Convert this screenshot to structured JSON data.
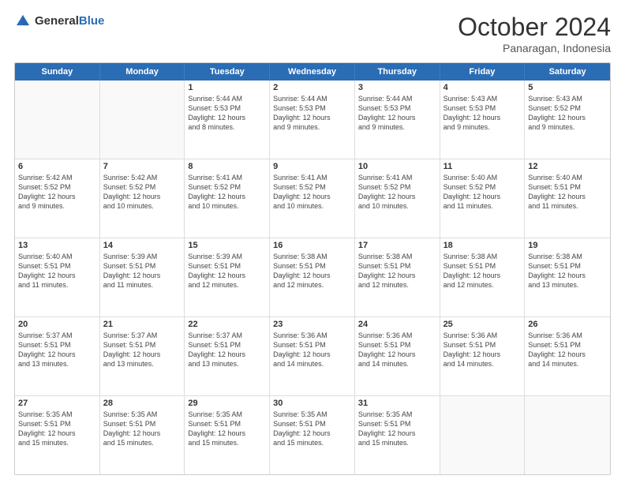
{
  "logo": {
    "general": "General",
    "blue": "Blue"
  },
  "title": {
    "month": "October 2024",
    "location": "Panaragan, Indonesia"
  },
  "weekdays": [
    "Sunday",
    "Monday",
    "Tuesday",
    "Wednesday",
    "Thursday",
    "Friday",
    "Saturday"
  ],
  "weeks": [
    [
      {
        "day": "",
        "text": "",
        "empty": true
      },
      {
        "day": "",
        "text": "",
        "empty": true
      },
      {
        "day": "1",
        "text": "Sunrise: 5:44 AM\nSunset: 5:53 PM\nDaylight: 12 hours\nand 8 minutes."
      },
      {
        "day": "2",
        "text": "Sunrise: 5:44 AM\nSunset: 5:53 PM\nDaylight: 12 hours\nand 9 minutes."
      },
      {
        "day": "3",
        "text": "Sunrise: 5:44 AM\nSunset: 5:53 PM\nDaylight: 12 hours\nand 9 minutes."
      },
      {
        "day": "4",
        "text": "Sunrise: 5:43 AM\nSunset: 5:53 PM\nDaylight: 12 hours\nand 9 minutes."
      },
      {
        "day": "5",
        "text": "Sunrise: 5:43 AM\nSunset: 5:52 PM\nDaylight: 12 hours\nand 9 minutes."
      }
    ],
    [
      {
        "day": "6",
        "text": "Sunrise: 5:42 AM\nSunset: 5:52 PM\nDaylight: 12 hours\nand 9 minutes."
      },
      {
        "day": "7",
        "text": "Sunrise: 5:42 AM\nSunset: 5:52 PM\nDaylight: 12 hours\nand 10 minutes."
      },
      {
        "day": "8",
        "text": "Sunrise: 5:41 AM\nSunset: 5:52 PM\nDaylight: 12 hours\nand 10 minutes."
      },
      {
        "day": "9",
        "text": "Sunrise: 5:41 AM\nSunset: 5:52 PM\nDaylight: 12 hours\nand 10 minutes."
      },
      {
        "day": "10",
        "text": "Sunrise: 5:41 AM\nSunset: 5:52 PM\nDaylight: 12 hours\nand 10 minutes."
      },
      {
        "day": "11",
        "text": "Sunrise: 5:40 AM\nSunset: 5:52 PM\nDaylight: 12 hours\nand 11 minutes."
      },
      {
        "day": "12",
        "text": "Sunrise: 5:40 AM\nSunset: 5:51 PM\nDaylight: 12 hours\nand 11 minutes."
      }
    ],
    [
      {
        "day": "13",
        "text": "Sunrise: 5:40 AM\nSunset: 5:51 PM\nDaylight: 12 hours\nand 11 minutes."
      },
      {
        "day": "14",
        "text": "Sunrise: 5:39 AM\nSunset: 5:51 PM\nDaylight: 12 hours\nand 11 minutes."
      },
      {
        "day": "15",
        "text": "Sunrise: 5:39 AM\nSunset: 5:51 PM\nDaylight: 12 hours\nand 12 minutes."
      },
      {
        "day": "16",
        "text": "Sunrise: 5:38 AM\nSunset: 5:51 PM\nDaylight: 12 hours\nand 12 minutes."
      },
      {
        "day": "17",
        "text": "Sunrise: 5:38 AM\nSunset: 5:51 PM\nDaylight: 12 hours\nand 12 minutes."
      },
      {
        "day": "18",
        "text": "Sunrise: 5:38 AM\nSunset: 5:51 PM\nDaylight: 12 hours\nand 12 minutes."
      },
      {
        "day": "19",
        "text": "Sunrise: 5:38 AM\nSunset: 5:51 PM\nDaylight: 12 hours\nand 13 minutes."
      }
    ],
    [
      {
        "day": "20",
        "text": "Sunrise: 5:37 AM\nSunset: 5:51 PM\nDaylight: 12 hours\nand 13 minutes."
      },
      {
        "day": "21",
        "text": "Sunrise: 5:37 AM\nSunset: 5:51 PM\nDaylight: 12 hours\nand 13 minutes."
      },
      {
        "day": "22",
        "text": "Sunrise: 5:37 AM\nSunset: 5:51 PM\nDaylight: 12 hours\nand 13 minutes."
      },
      {
        "day": "23",
        "text": "Sunrise: 5:36 AM\nSunset: 5:51 PM\nDaylight: 12 hours\nand 14 minutes."
      },
      {
        "day": "24",
        "text": "Sunrise: 5:36 AM\nSunset: 5:51 PM\nDaylight: 12 hours\nand 14 minutes."
      },
      {
        "day": "25",
        "text": "Sunrise: 5:36 AM\nSunset: 5:51 PM\nDaylight: 12 hours\nand 14 minutes."
      },
      {
        "day": "26",
        "text": "Sunrise: 5:36 AM\nSunset: 5:51 PM\nDaylight: 12 hours\nand 14 minutes."
      }
    ],
    [
      {
        "day": "27",
        "text": "Sunrise: 5:35 AM\nSunset: 5:51 PM\nDaylight: 12 hours\nand 15 minutes."
      },
      {
        "day": "28",
        "text": "Sunrise: 5:35 AM\nSunset: 5:51 PM\nDaylight: 12 hours\nand 15 minutes."
      },
      {
        "day": "29",
        "text": "Sunrise: 5:35 AM\nSunset: 5:51 PM\nDaylight: 12 hours\nand 15 minutes."
      },
      {
        "day": "30",
        "text": "Sunrise: 5:35 AM\nSunset: 5:51 PM\nDaylight: 12 hours\nand 15 minutes."
      },
      {
        "day": "31",
        "text": "Sunrise: 5:35 AM\nSunset: 5:51 PM\nDaylight: 12 hours\nand 15 minutes."
      },
      {
        "day": "",
        "text": "",
        "empty": true
      },
      {
        "day": "",
        "text": "",
        "empty": true
      }
    ]
  ]
}
